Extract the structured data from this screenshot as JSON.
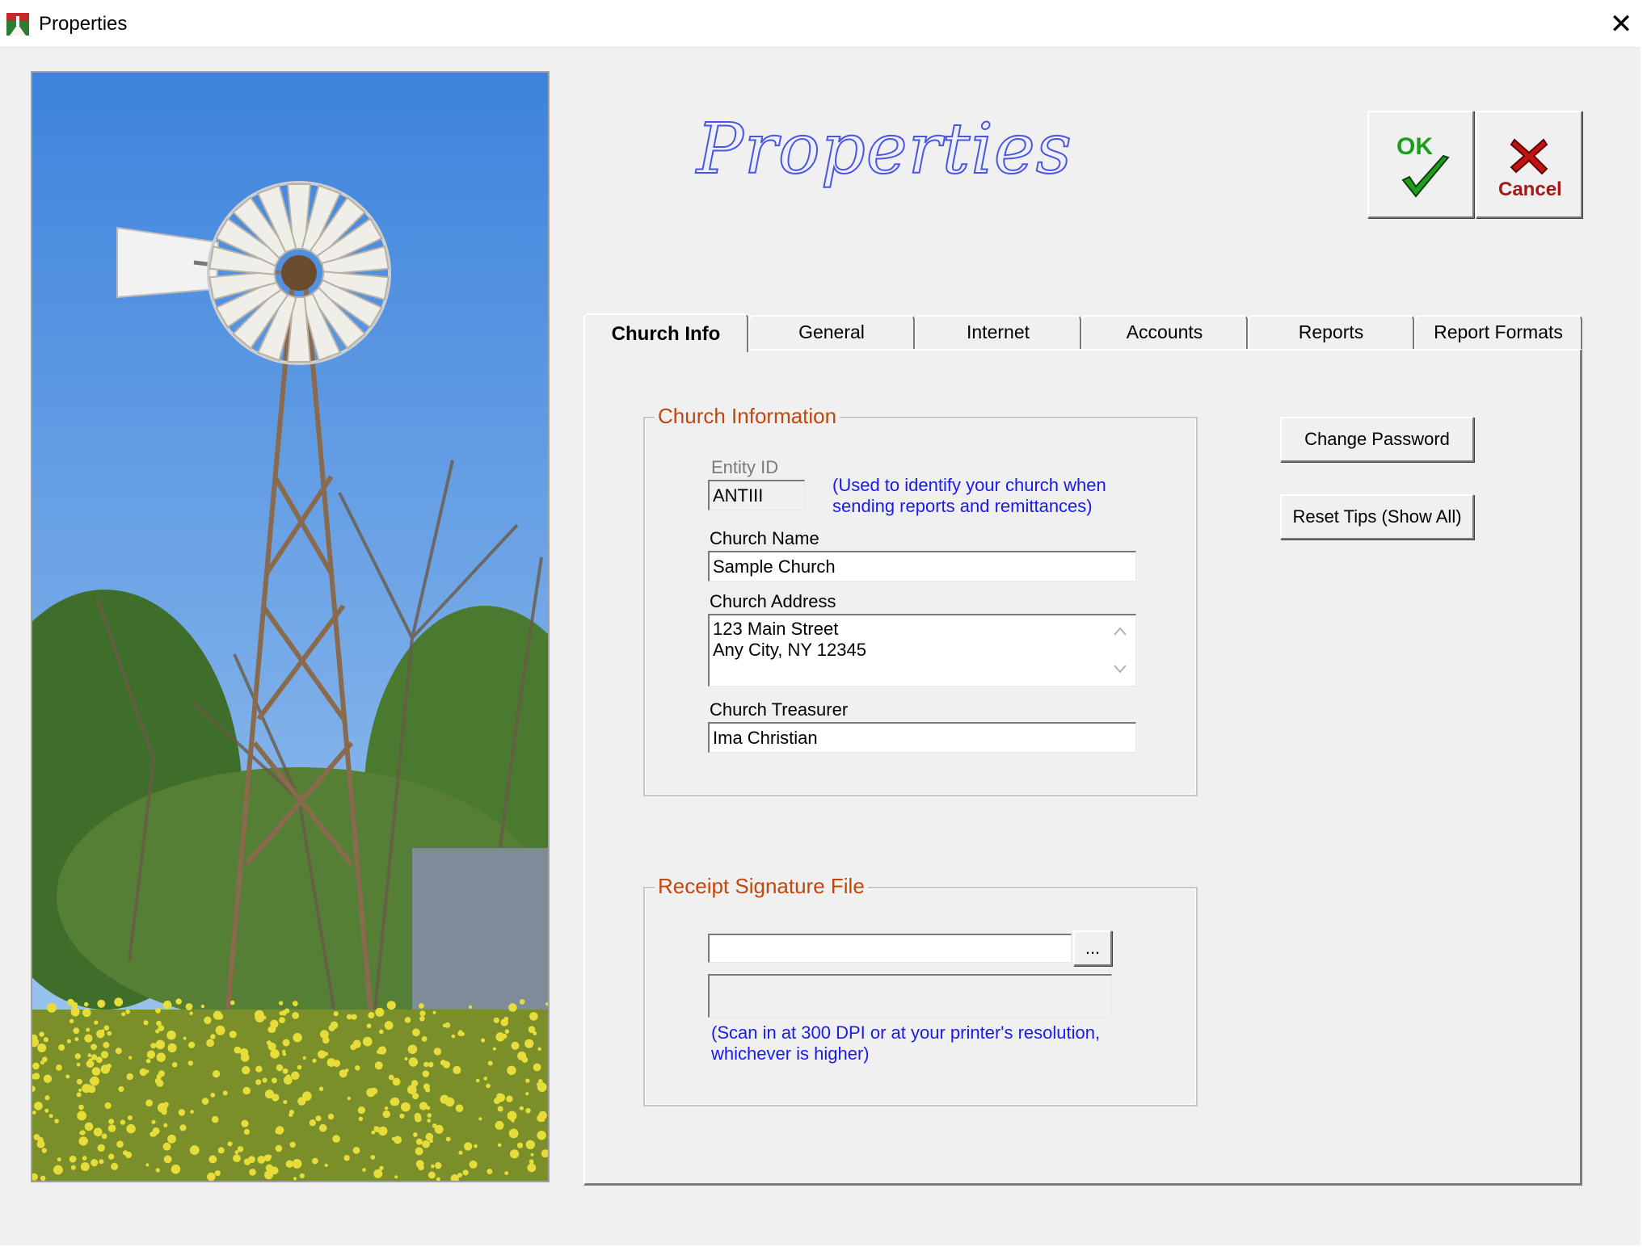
{
  "window": {
    "title": "Properties",
    "close_glyph": "✕"
  },
  "heading": "Properties",
  "buttons": {
    "ok": "OK",
    "cancel": "Cancel"
  },
  "tabs": [
    {
      "label": "Church Info",
      "active": true
    },
    {
      "label": "General"
    },
    {
      "label": "Internet"
    },
    {
      "label": "Accounts"
    },
    {
      "label": "Reports"
    },
    {
      "label": "Report Formats"
    }
  ],
  "church_info": {
    "group_title": "Church Information",
    "entity_id_label": "Entity ID",
    "entity_id_value": "ANTIII",
    "entity_id_hint": "(Used to identify your church when sending reports and remittances)",
    "church_name_label": "Church Name",
    "church_name_value": "Sample Church",
    "church_address_label": "Church Address",
    "church_address_value": "123 Main Street\nAny City, NY 12345",
    "church_treasurer_label": "Church Treasurer",
    "church_treasurer_value": "Ima Christian"
  },
  "signature": {
    "group_title": "Receipt Signature File",
    "file_value": "",
    "browse_label": "...",
    "hint": "(Scan in at 300 DPI or at your printer's resolution, whichever is higher)"
  },
  "side_buttons": {
    "change_password": "Change Password",
    "reset_tips": "Reset Tips (Show All)"
  },
  "icons": {
    "app": "church-app-icon",
    "ok": "checkmark-icon",
    "cancel": "x-icon",
    "scroll_up": "chevron-up-icon",
    "scroll_down": "chevron-down-icon"
  },
  "colors": {
    "group_title": "#c0470f",
    "hint_text": "#1a1aee",
    "ok_green": "#19a019",
    "cancel_red": "#a11a1a",
    "heading_blue": "#4a55e0"
  }
}
